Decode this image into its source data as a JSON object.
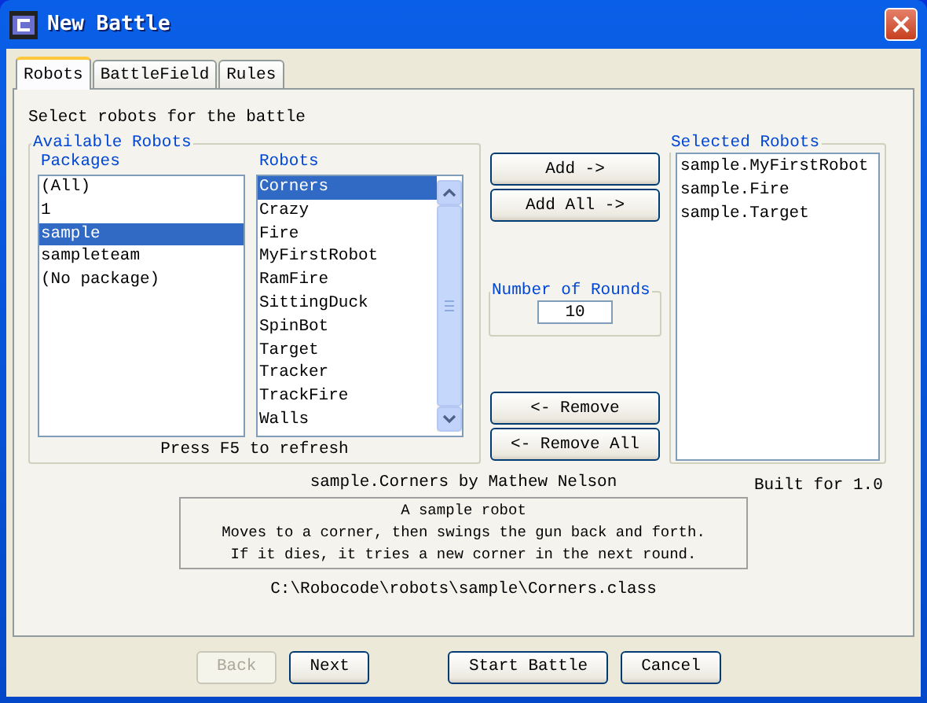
{
  "window": {
    "title": "New Battle"
  },
  "tabs": [
    {
      "label": "Robots",
      "selected": true
    },
    {
      "label": "BattleField",
      "selected": false
    },
    {
      "label": "Rules",
      "selected": false
    }
  ],
  "instruction": "Select robots for the battle",
  "available_robots": {
    "title": "Available Robots",
    "packages": {
      "heading": "Packages",
      "items": [
        {
          "label": "(All)",
          "selected": false
        },
        {
          "label": "1",
          "selected": false
        },
        {
          "label": "sample",
          "selected": true
        },
        {
          "label": "sampleteam",
          "selected": false
        },
        {
          "label": "(No package)",
          "selected": false
        }
      ]
    },
    "robots": {
      "heading": "Robots",
      "items": [
        {
          "label": "Corners",
          "selected": true
        },
        {
          "label": "Crazy",
          "selected": false
        },
        {
          "label": "Fire",
          "selected": false
        },
        {
          "label": "MyFirstRobot",
          "selected": false
        },
        {
          "label": "RamFire",
          "selected": false
        },
        {
          "label": "SittingDuck",
          "selected": false
        },
        {
          "label": "SpinBot",
          "selected": false
        },
        {
          "label": "Target",
          "selected": false
        },
        {
          "label": "Tracker",
          "selected": false
        },
        {
          "label": "TrackFire",
          "selected": false
        },
        {
          "label": "Walls",
          "selected": false
        }
      ]
    },
    "hint": "Press F5 to refresh"
  },
  "add_buttons": [
    "Add ->",
    "Add All ->"
  ],
  "rounds": {
    "title": "Number of Rounds",
    "value": "10"
  },
  "remove_buttons": [
    "<- Remove",
    "<- Remove All"
  ],
  "selected_robots": {
    "title": "Selected Robots",
    "items": [
      "sample.MyFirstRobot",
      "sample.Fire",
      "sample.Target"
    ]
  },
  "robot_info": {
    "name_line": "sample.Corners by Mathew Nelson",
    "built_for": "Built for 1.0",
    "description": [
      "A sample robot",
      "Moves to a corner, then swings the gun back and forth.",
      "If it dies, it tries a new corner in the next round."
    ],
    "path": "C:\\Robocode\\robots\\sample\\Corners.class"
  },
  "footer_buttons": [
    {
      "label": "Back",
      "disabled": true
    },
    {
      "label": "Next",
      "disabled": false
    },
    {
      "label": "Start Battle",
      "disabled": false
    },
    {
      "label": "Cancel",
      "disabled": false
    }
  ]
}
